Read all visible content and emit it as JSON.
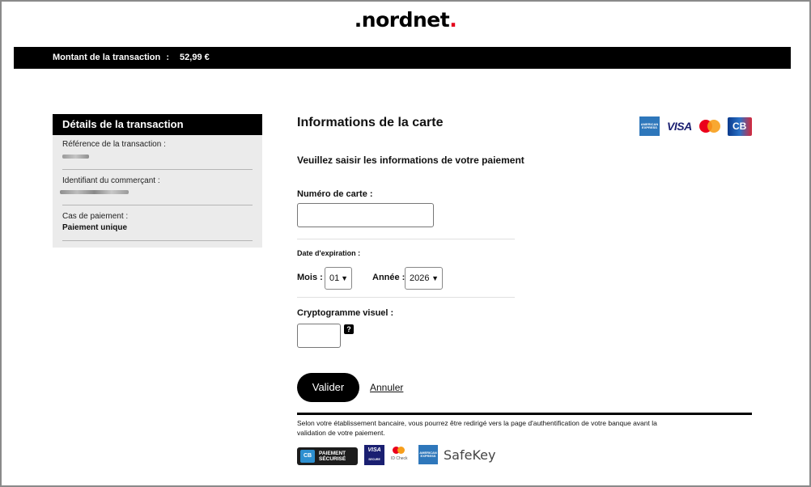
{
  "logo": {
    "prefix": ".nordnet",
    "suffix": "."
  },
  "amount_bar": {
    "label": "Montant de la transaction",
    "separator": ":",
    "amount": "52,99 €"
  },
  "details": {
    "title": "Détails de la transaction",
    "reference_label": "Référence de la transaction :",
    "merchant_label": "Identifiant du commerçant :",
    "payment_case_label": "Cas de paiement :",
    "payment_case_value": "Paiement unique"
  },
  "form": {
    "title": "Informations de la carte",
    "subtitle": "Veuillez saisir les informations de votre paiement",
    "card_number_label": "Numéro de carte :",
    "card_number_value": "",
    "expiry_label": "Date d'expiration :",
    "month_label": "Mois :",
    "month_value": "01",
    "year_label": "Année :",
    "year_value": "2026",
    "cvv_label": "Cryptogramme visuel :",
    "cvv_value": "",
    "help_glyph": "?",
    "submit_label": "Valider",
    "cancel_label": "Annuler"
  },
  "card_logos": [
    {
      "name": "amex-logo",
      "text": "AMERICAN EXPRESS"
    },
    {
      "name": "visa-logo",
      "text": "VISA"
    },
    {
      "name": "mastercard-logo",
      "text": ""
    },
    {
      "name": "cb-logo",
      "text": "CB"
    }
  ],
  "notice": "Selon votre établissement bancaire, vous pourrez être redirigé vers la page d'authentification de votre banque avant la validation de votre paiement.",
  "security_badges": {
    "cb_line1": "PAIEMENT",
    "cb_line2": "SÉCURISÉ",
    "visa": "VISA",
    "visa_sub": "SECURE",
    "mc_sub": "ID Check",
    "amex": "AMERICAN EXPRESS",
    "safekey": "SafeKey"
  },
  "colors": {
    "accent": "#e3001b",
    "primary": "#000000",
    "panel": "#ebebeb"
  }
}
